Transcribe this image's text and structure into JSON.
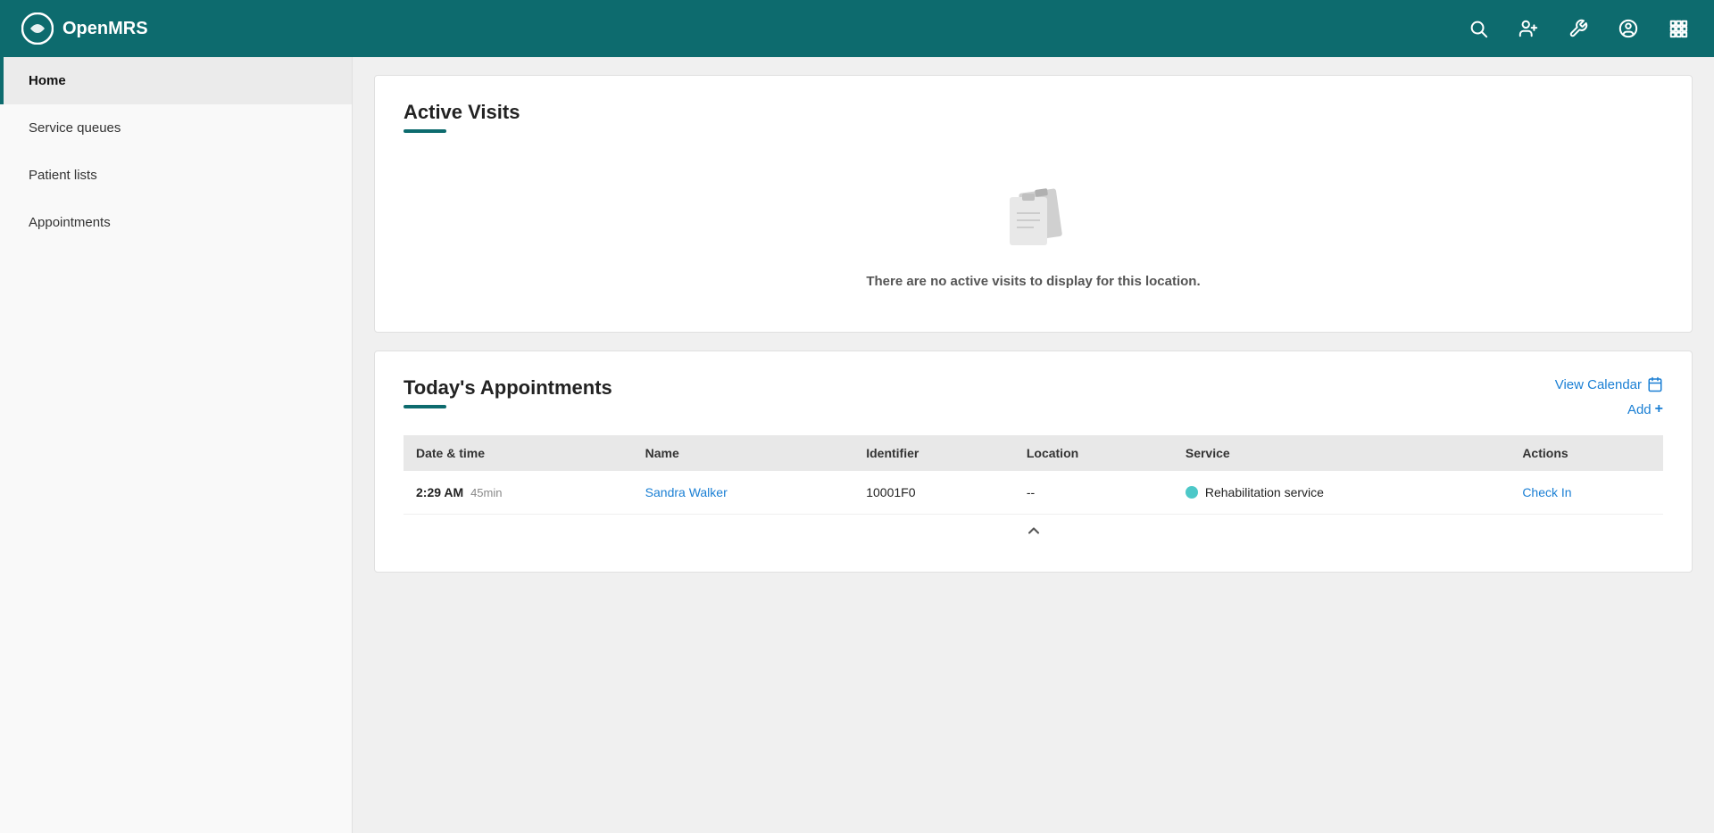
{
  "app": {
    "name": "OpenMRS"
  },
  "topnav": {
    "icons": [
      "search",
      "add-user",
      "settings",
      "profile",
      "grid"
    ]
  },
  "sidebar": {
    "items": [
      {
        "label": "Home",
        "active": true
      },
      {
        "label": "Service queues",
        "active": false
      },
      {
        "label": "Patient lists",
        "active": false
      },
      {
        "label": "Appointments",
        "active": false
      }
    ]
  },
  "active_visits": {
    "title": "Active Visits",
    "empty_message": "There are no active visits to display for this location."
  },
  "appointments": {
    "title": "Today's Appointments",
    "view_calendar_label": "View Calendar",
    "add_label": "Add",
    "table": {
      "headers": [
        "Date & time",
        "Name",
        "Identifier",
        "Location",
        "Service",
        "Actions"
      ],
      "rows": [
        {
          "date_time": "2:29 AM",
          "duration": "45min",
          "name": "Sandra Walker",
          "identifier": "10001F0",
          "location": "--",
          "service": "Rehabilitation service",
          "action": "Check In"
        }
      ]
    }
  }
}
